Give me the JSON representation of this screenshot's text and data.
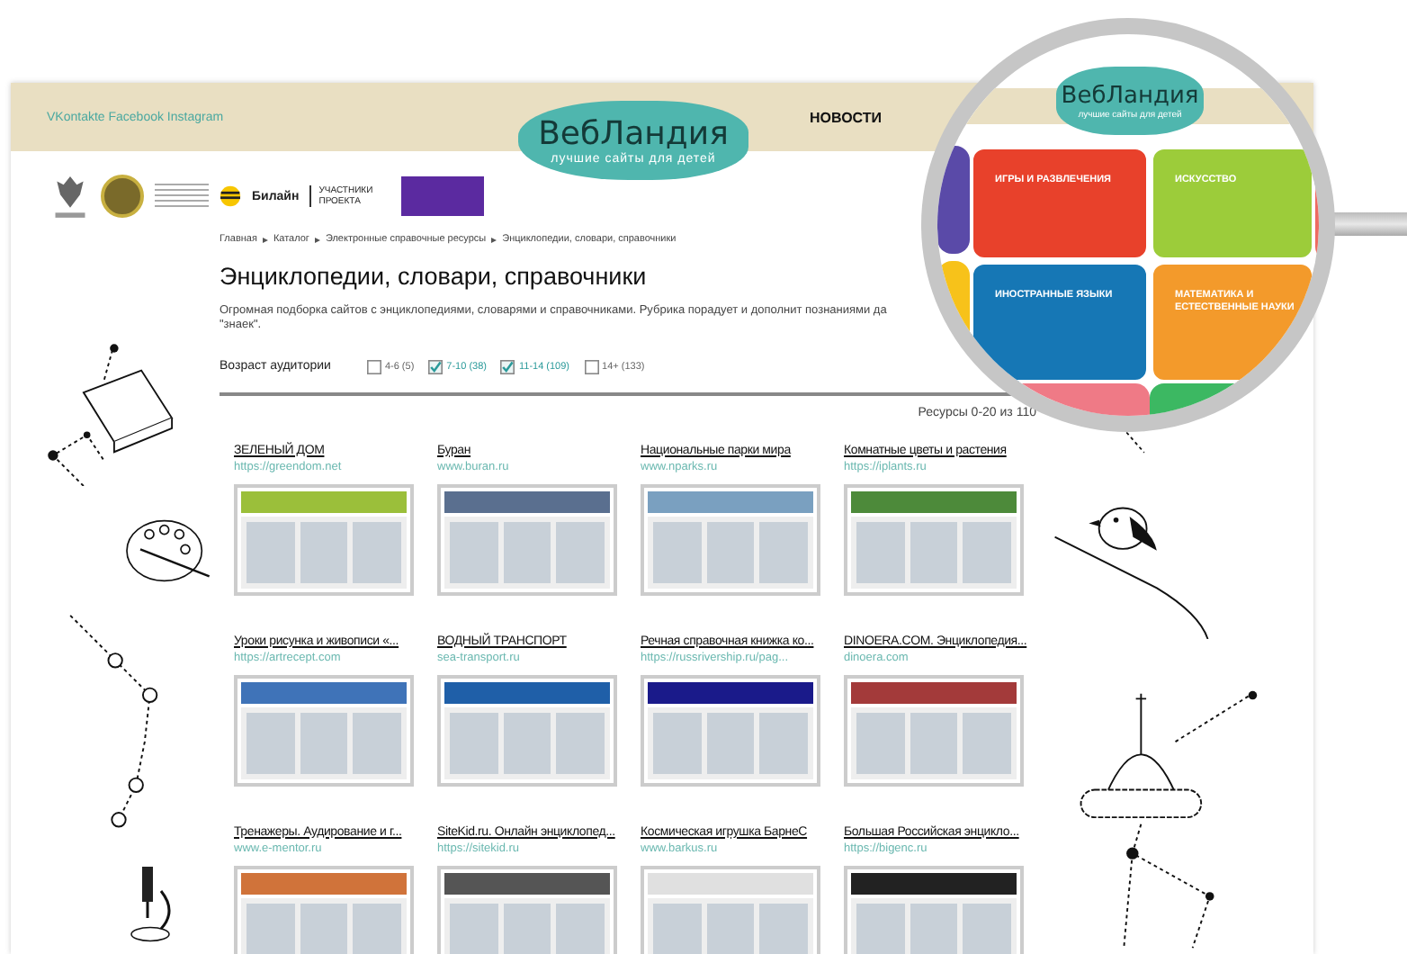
{
  "header": {
    "social": "VKontakte Facebook Instagram",
    "logo": {
      "title": "ВебЛандия",
      "tagline": "лучшие сайты для детей"
    },
    "nav": [
      "НОВОСТИ"
    ]
  },
  "partners": {
    "brand": "Билайн",
    "participants": "УЧАСТНИКИ ПРОЕКТА"
  },
  "breadcrumb": [
    "Главная",
    "Каталог",
    "Электронные справочные ресурсы",
    "Энциклопедии, словари, справочники"
  ],
  "title": "Энциклопедии, словари, справочники",
  "description": "Огромная подборка сайтов с энциклопедиями, словарями и справочниками. Рубрика порадует и дополнит познаниями да\n\"знаек\".",
  "filter": {
    "label": "Возраст аудитории",
    "options": [
      {
        "label": "4-6 (5)",
        "checked": false
      },
      {
        "label": "7-10 (38)",
        "checked": true
      },
      {
        "label": "11-14 (109)",
        "checked": true
      },
      {
        "label": "14+ (133)",
        "checked": false
      }
    ]
  },
  "results": "Ресурсы 0-20 из 110",
  "sites": [
    {
      "title": "ЗЕЛЕНЫЙ ДОМ",
      "url": "https://greendom.net"
    },
    {
      "title": "Буран",
      "url": "www.buran.ru"
    },
    {
      "title": "Национальные парки мира",
      "url": "www.nparks.ru"
    },
    {
      "title": "Комнатные цветы и растения",
      "url": "https://iplants.ru"
    },
    {
      "title": "Уроки рисунка и живописи «...",
      "url": "https://artrecept.com"
    },
    {
      "title": "ВОДНЫЙ ТРАНСПОРТ",
      "url": "sea-transport.ru"
    },
    {
      "title": "Речная справочная книжка ко...",
      "url": "https://russrivership.ru/pag..."
    },
    {
      "title": "DINOERA.COM. Энциклопедия...",
      "url": "dinoera.com"
    },
    {
      "title": "Тренажеры. Аудирование и г...",
      "url": "www.e-mentor.ru"
    },
    {
      "title": "SiteKid.ru. Онлайн энциклопед...",
      "url": "https://sitekid.ru"
    },
    {
      "title": "Космическая игрушка БарнеС",
      "url": "www.barkus.ru"
    },
    {
      "title": "Большая Российская энцикло...",
      "url": "https://bigenc.ru"
    }
  ],
  "magnifier": {
    "logo": {
      "title": "ВебЛандия",
      "tagline": "лучшие сайты для детей"
    },
    "tiles": [
      {
        "label": "ИГРЫ И РАЗВЛЕЧЕНИЯ",
        "color": "#e8412b"
      },
      {
        "label": "ИСКУССТВО",
        "color": "#9ccc3a"
      },
      {
        "label": "ИНОСТРАННЫЕ ЯЗЫКИ",
        "color": "#1677b5"
      },
      {
        "label": "МАТЕМАТИКА И ЕСТЕСТВЕННЫЕ НАУКИ",
        "color": "#f39a2b"
      }
    ]
  }
}
